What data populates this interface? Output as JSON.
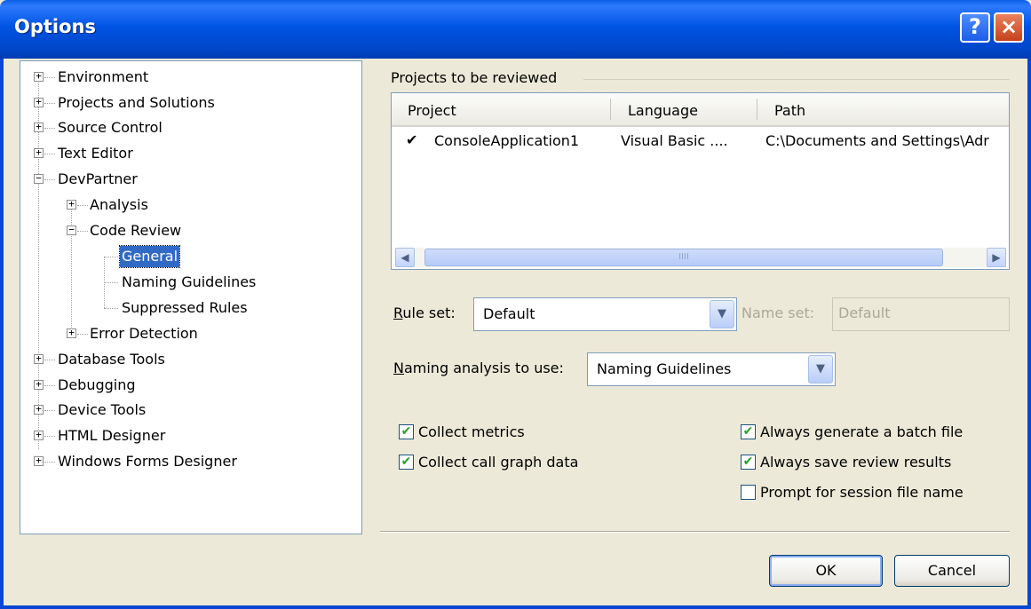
{
  "window": {
    "title": "Options",
    "help_glyph": "?",
    "close_glyph": "×"
  },
  "tree": {
    "items": [
      {
        "label": "Environment",
        "expander": "+"
      },
      {
        "label": "Projects and Solutions",
        "expander": "+"
      },
      {
        "label": "Source Control",
        "expander": "+"
      },
      {
        "label": "Text Editor",
        "expander": "+"
      },
      {
        "label": "DevPartner",
        "expander": "−"
      },
      {
        "label": "Analysis",
        "expander": "+"
      },
      {
        "label": "Code Review",
        "expander": "−"
      },
      {
        "label": "General",
        "expander": "",
        "selected": true
      },
      {
        "label": "Naming Guidelines",
        "expander": ""
      },
      {
        "label": "Suppressed Rules",
        "expander": ""
      },
      {
        "label": "Error Detection",
        "expander": "+"
      },
      {
        "label": "Database Tools",
        "expander": "+"
      },
      {
        "label": "Debugging",
        "expander": "+"
      },
      {
        "label": "Device Tools",
        "expander": "+"
      },
      {
        "label": "HTML Designer",
        "expander": "+"
      },
      {
        "label": "Windows Forms Designer",
        "expander": "+"
      }
    ]
  },
  "projects": {
    "caption": "Projects to be reviewed",
    "columns": [
      "Project",
      "Language",
      "Path"
    ],
    "rows": [
      {
        "checked": true,
        "check_glyph": "✔",
        "project": "ConsoleApplication1",
        "language": "Visual Basic ....",
        "path": "C:\\Documents and Settings\\Adr"
      }
    ],
    "scroll_left": "◀",
    "scroll_right": "▶",
    "scroll_grip": "IIII"
  },
  "rule_set": {
    "label_ul": "R",
    "label_rest": "ule set:",
    "value": "Default",
    "arrow": "▼"
  },
  "name_set": {
    "label": "Name set:",
    "value": "Default"
  },
  "naming": {
    "label_ul": "N",
    "label_rest": "aming analysis to use:",
    "value": "Naming Guidelines",
    "arrow": "▼"
  },
  "options": {
    "collect_metrics": {
      "checked": true,
      "ul": "C",
      "rest": "ollect metrics",
      "glyph": "✔"
    },
    "collect_call_graph": {
      "checked": true,
      "pre": "Collect call ",
      "ul": "g",
      "rest": "raph data",
      "glyph": "✔"
    },
    "always_batch": {
      "checked": true,
      "pre": "Always generate a ",
      "ul": "b",
      "rest": "atch file",
      "glyph": "✔"
    },
    "always_save": {
      "checked": true,
      "pre": "Always ",
      "ul": "s",
      "rest": "ave review results",
      "glyph": "✔"
    },
    "prompt_session": {
      "checked": false,
      "ul": "P",
      "rest": "rompt for session file name",
      "glyph": ""
    }
  },
  "buttons": {
    "ok": "OK",
    "cancel": "Cancel"
  },
  "colors": {
    "title_bar": "#0054e3",
    "selection": "#316ac5",
    "dialog_bg": "#ece9d8"
  }
}
